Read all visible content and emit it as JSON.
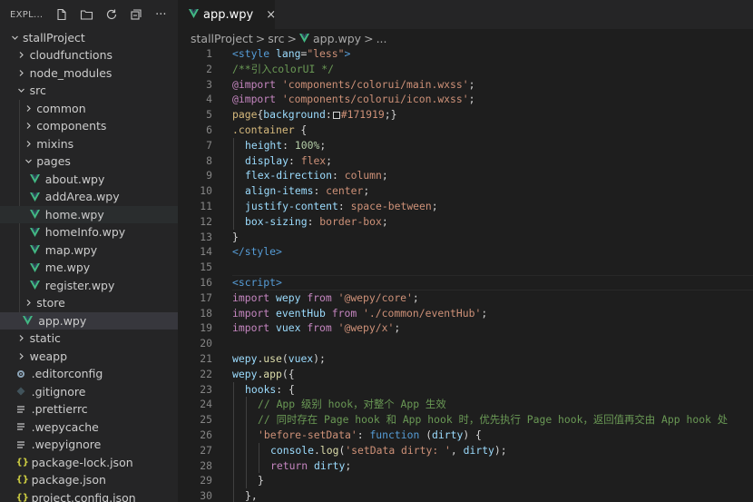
{
  "explorer": {
    "title": "EXPL...",
    "actions": [
      "new-file",
      "new-folder",
      "refresh",
      "collapse-all",
      "more"
    ]
  },
  "tree": [
    {
      "label": "stallProject",
      "kind": "folder-open",
      "depth": 0
    },
    {
      "label": "cloudfunctions",
      "kind": "folder",
      "depth": 1
    },
    {
      "label": "node_modules",
      "kind": "folder",
      "depth": 1
    },
    {
      "label": "src",
      "kind": "folder-open",
      "depth": 1
    },
    {
      "label": "common",
      "kind": "folder",
      "depth": 2
    },
    {
      "label": "components",
      "kind": "folder",
      "depth": 2
    },
    {
      "label": "mixins",
      "kind": "folder",
      "depth": 2
    },
    {
      "label": "pages",
      "kind": "folder-open",
      "depth": 2
    },
    {
      "label": "about.wpy",
      "kind": "vue",
      "depth": 3
    },
    {
      "label": "addArea.wpy",
      "kind": "vue",
      "depth": 3
    },
    {
      "label": "home.wpy",
      "kind": "vue",
      "depth": 3,
      "state": "hover"
    },
    {
      "label": "homeInfo.wpy",
      "kind": "vue",
      "depth": 3
    },
    {
      "label": "map.wpy",
      "kind": "vue",
      "depth": 3
    },
    {
      "label": "me.wpy",
      "kind": "vue",
      "depth": 3
    },
    {
      "label": "register.wpy",
      "kind": "vue",
      "depth": 3
    },
    {
      "label": "store",
      "kind": "folder",
      "depth": 2
    },
    {
      "label": "app.wpy",
      "kind": "vue",
      "depth": 2,
      "state": "active"
    },
    {
      "label": "static",
      "kind": "folder",
      "depth": 1
    },
    {
      "label": "weapp",
      "kind": "folder",
      "depth": 1
    },
    {
      "label": ".editorconfig",
      "kind": "gear",
      "depth": 1
    },
    {
      "label": ".gitignore",
      "kind": "git",
      "depth": 1
    },
    {
      "label": ".prettierrc",
      "kind": "lines",
      "depth": 1
    },
    {
      "label": ".wepycache",
      "kind": "lines",
      "depth": 1
    },
    {
      "label": ".wepyignore",
      "kind": "lines",
      "depth": 1
    },
    {
      "label": "package-lock.json",
      "kind": "json",
      "depth": 1
    },
    {
      "label": "package.json",
      "kind": "json",
      "depth": 1
    },
    {
      "label": "project.config.json",
      "kind": "json",
      "depth": 1
    }
  ],
  "tab": {
    "label": "app.wpy",
    "close": "×"
  },
  "breadcrumb": {
    "parts": [
      "stallProject",
      "src",
      "app.wpy",
      "..."
    ],
    "sep": ">"
  },
  "colors": {
    "vue": "#42b883",
    "json": "#cbcb41",
    "gear": "#8da5b8",
    "git": "#41535b",
    "lines": "#c5c5c5"
  },
  "code": [
    {
      "n": "1",
      "indent": 0,
      "t": [
        [
          "tag",
          "<style "
        ],
        [
          "attr",
          "lang"
        ],
        [
          "p",
          "="
        ],
        [
          "str",
          "\"less\""
        ],
        [
          "tag",
          ">"
        ]
      ]
    },
    {
      "n": "2",
      "indent": 0,
      "t": [
        [
          "cmt",
          "/**引入colorUI */"
        ]
      ]
    },
    {
      "n": "3",
      "indent": 0,
      "t": [
        [
          "key",
          "@import "
        ],
        [
          "str",
          "'components/colorui/main.wxss'"
        ],
        [
          "p",
          ";"
        ]
      ]
    },
    {
      "n": "4",
      "indent": 0,
      "t": [
        [
          "key",
          "@import "
        ],
        [
          "str",
          "'components/colorui/icon.wxss'"
        ],
        [
          "p",
          ";"
        ]
      ]
    },
    {
      "n": "5",
      "indent": 0,
      "t": [
        [
          "sel",
          "page"
        ],
        [
          "p",
          "{"
        ],
        [
          "prop",
          "background"
        ],
        [
          "p",
          ":"
        ],
        [
          "swatch",
          ""
        ],
        [
          "str",
          "#171919"
        ],
        [
          "p",
          ";}"
        ]
      ]
    },
    {
      "n": "6",
      "indent": 0,
      "t": [
        [
          "sel",
          ".container"
        ],
        [
          "p",
          " {"
        ]
      ]
    },
    {
      "n": "7",
      "indent": 1,
      "t": [
        [
          "prop",
          "height"
        ],
        [
          "p",
          ": "
        ],
        [
          "num",
          "100%"
        ],
        [
          "p",
          ";"
        ]
      ]
    },
    {
      "n": "8",
      "indent": 1,
      "t": [
        [
          "prop",
          "display"
        ],
        [
          "p",
          ": "
        ],
        [
          "str",
          "flex"
        ],
        [
          "p",
          ";"
        ]
      ]
    },
    {
      "n": "9",
      "indent": 1,
      "t": [
        [
          "prop",
          "flex-direction"
        ],
        [
          "p",
          ": "
        ],
        [
          "str",
          "column"
        ],
        [
          "p",
          ";"
        ]
      ]
    },
    {
      "n": "10",
      "indent": 1,
      "t": [
        [
          "prop",
          "align-items"
        ],
        [
          "p",
          ": "
        ],
        [
          "str",
          "center"
        ],
        [
          "p",
          ";"
        ]
      ]
    },
    {
      "n": "11",
      "indent": 1,
      "t": [
        [
          "prop",
          "justify-content"
        ],
        [
          "p",
          ": "
        ],
        [
          "str",
          "space-between"
        ],
        [
          "p",
          ";"
        ]
      ]
    },
    {
      "n": "12",
      "indent": 1,
      "t": [
        [
          "prop",
          "box-sizing"
        ],
        [
          "p",
          ": "
        ],
        [
          "str",
          "border-box"
        ],
        [
          "p",
          ";"
        ]
      ]
    },
    {
      "n": "13",
      "indent": 0,
      "t": [
        [
          "p",
          "}"
        ]
      ]
    },
    {
      "n": "14",
      "indent": 0,
      "t": [
        [
          "tag",
          "</style>"
        ]
      ]
    },
    {
      "n": "15",
      "indent": 0,
      "t": []
    },
    {
      "n": "16",
      "indent": 0,
      "current": true,
      "t": [
        [
          "tag",
          "<script>"
        ]
      ]
    },
    {
      "n": "17",
      "indent": 0,
      "t": [
        [
          "key",
          "import "
        ],
        [
          "var",
          "wepy "
        ],
        [
          "key",
          "from "
        ],
        [
          "str",
          "'@wepy/core'"
        ],
        [
          "p",
          ";"
        ]
      ]
    },
    {
      "n": "18",
      "indent": 0,
      "t": [
        [
          "key",
          "import "
        ],
        [
          "var",
          "eventHub "
        ],
        [
          "key",
          "from "
        ],
        [
          "str",
          "'./common/eventHub'"
        ],
        [
          "p",
          ";"
        ]
      ]
    },
    {
      "n": "19",
      "indent": 0,
      "t": [
        [
          "key",
          "import "
        ],
        [
          "var",
          "vuex "
        ],
        [
          "key",
          "from "
        ],
        [
          "str",
          "'@wepy/x'"
        ],
        [
          "p",
          ";"
        ]
      ]
    },
    {
      "n": "20",
      "indent": 0,
      "t": []
    },
    {
      "n": "21",
      "indent": 0,
      "t": [
        [
          "var",
          "wepy"
        ],
        [
          "p",
          "."
        ],
        [
          "fn",
          "use"
        ],
        [
          "p",
          "("
        ],
        [
          "var",
          "vuex"
        ],
        [
          "p",
          ");"
        ]
      ]
    },
    {
      "n": "22",
      "indent": 0,
      "t": [
        [
          "var",
          "wepy"
        ],
        [
          "p",
          "."
        ],
        [
          "fn",
          "app"
        ],
        [
          "p",
          "({"
        ]
      ]
    },
    {
      "n": "23",
      "indent": 1,
      "t": [
        [
          "prop",
          "hooks"
        ],
        [
          "p",
          ": {"
        ]
      ]
    },
    {
      "n": "24",
      "indent": 2,
      "t": [
        [
          "cmt",
          "// App 级别 hook，对整个 App 生效"
        ]
      ]
    },
    {
      "n": "25",
      "indent": 2,
      "t": [
        [
          "cmt",
          "// 同时存在 Page hook 和 App hook 时，优先执行 Page hook，返回值再交由 App hook 处"
        ]
      ]
    },
    {
      "n": "26",
      "indent": 2,
      "t": [
        [
          "str",
          "'before-setData'"
        ],
        [
          "p",
          ": "
        ],
        [
          "kw",
          "function "
        ],
        [
          "p",
          "("
        ],
        [
          "var",
          "dirty"
        ],
        [
          "p",
          ") {"
        ]
      ]
    },
    {
      "n": "27",
      "indent": 3,
      "t": [
        [
          "var",
          "console"
        ],
        [
          "p",
          "."
        ],
        [
          "fn",
          "log"
        ],
        [
          "p",
          "("
        ],
        [
          "str",
          "'setData dirty: '"
        ],
        [
          "p",
          ", "
        ],
        [
          "var",
          "dirty"
        ],
        [
          "p",
          ");"
        ]
      ]
    },
    {
      "n": "28",
      "indent": 3,
      "t": [
        [
          "key",
          "return "
        ],
        [
          "var",
          "dirty"
        ],
        [
          "p",
          ";"
        ]
      ]
    },
    {
      "n": "29",
      "indent": 2,
      "t": [
        [
          "p",
          "}"
        ]
      ]
    },
    {
      "n": "30",
      "indent": 1,
      "t": [
        [
          "p",
          "},"
        ]
      ]
    }
  ]
}
